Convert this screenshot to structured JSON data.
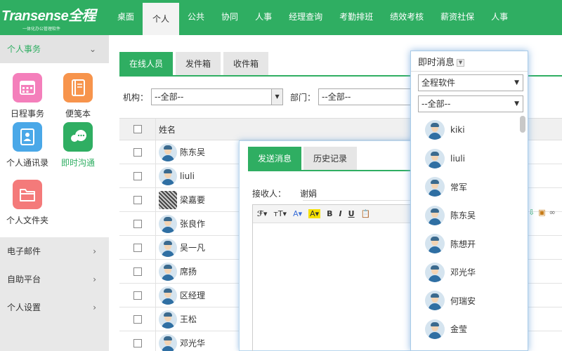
{
  "logo": {
    "brand": "Transense全程",
    "slogan": "一体化办公管理软件"
  },
  "nav": [
    "桌面",
    "个人",
    "公共",
    "协同",
    "人事",
    "经理查询",
    "考勤排班",
    "绩效考核",
    "薪资社保",
    "人事"
  ],
  "sidebar": {
    "open_section": "个人事务",
    "apps": [
      {
        "label": "日程事务",
        "color": "#f47fbb",
        "icon": "calendar-icon"
      },
      {
        "label": "便笺本",
        "color": "#f7944c",
        "icon": "notebook-icon"
      },
      {
        "label": "个人通讯录",
        "color": "#4aa8e8",
        "icon": "contacts-icon"
      },
      {
        "label": "即时沟通",
        "color": "#2fae62",
        "icon": "chat-icon"
      },
      {
        "label": "个人文件夹",
        "color": "#f47a7a",
        "icon": "folder-icon"
      }
    ],
    "sections": [
      "电子邮件",
      "自助平台",
      "个人设置"
    ]
  },
  "main": {
    "tabs": [
      "在线人员",
      "发件箱",
      "收件箱"
    ],
    "filter": {
      "org_label": "机构：",
      "org_value": "--全部--",
      "dept_label": "部门：",
      "dept_value": "--全部--"
    },
    "table": {
      "header": "姓名",
      "rows": [
        "陈东吴",
        "liuli",
        "梁嘉要",
        "张良作",
        "吴一凡",
        "席扬",
        "区经理",
        "王松",
        "邓光华"
      ]
    }
  },
  "dialog": {
    "tabs": [
      "发送消息",
      "历史记录"
    ],
    "receiver_label": "接收人：",
    "receiver_value": "谢娟"
  },
  "im": {
    "title": "即时消息",
    "company": "全程软件",
    "dept": "--全部--",
    "contacts": [
      "kiki",
      "liuli",
      "常军",
      "陈东吴",
      "陈想开",
      "邓光华",
      "何瑞安",
      "金莹"
    ]
  }
}
